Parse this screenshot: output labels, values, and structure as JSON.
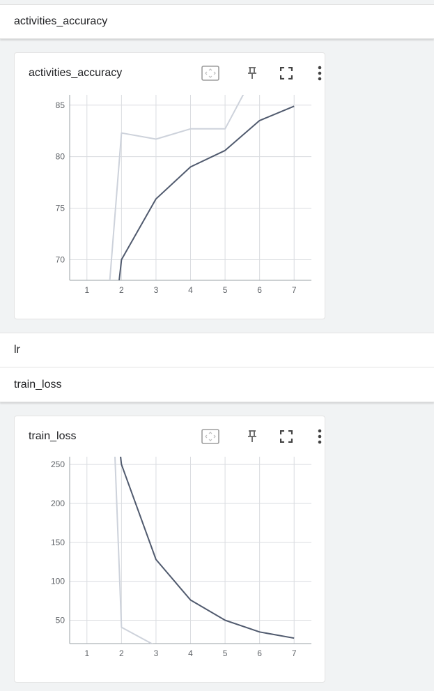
{
  "sections": {
    "activities_header": "activities_accuracy",
    "lr_header": "lr",
    "train_loss_header": "train_loss"
  },
  "cards": [
    {
      "title": "activities_accuracy",
      "tools": [
        "fit-domain-icon",
        "pin-icon",
        "fullscreen-icon",
        "more-vert-icon"
      ]
    },
    {
      "title": "train_loss",
      "tools": [
        "fit-domain-icon",
        "pin-icon",
        "fullscreen-icon",
        "more-vert-icon"
      ]
    }
  ],
  "colors": {
    "main_series": "#505a6e",
    "faded_series": "#cdd2db",
    "grid": "#dadce0",
    "axis": "#9aa0a6"
  },
  "chart_data": [
    {
      "type": "line",
      "title": "activities_accuracy",
      "x_ticks": [
        1,
        2,
        3,
        4,
        5,
        6,
        7
      ],
      "y_ticks": [
        70,
        75,
        80,
        85
      ],
      "xlim": [
        0.5,
        7.5
      ],
      "ylim": [
        68,
        86
      ],
      "series": [
        {
          "role": "raw",
          "x": [
            1,
            2,
            3,
            4,
            5,
            6
          ],
          "y": [
            40,
            82.3,
            81.7,
            82.7,
            82.7,
            89.0
          ]
        },
        {
          "role": "smoothed",
          "x": [
            1,
            2,
            3,
            4,
            5,
            6,
            7
          ],
          "y": [
            40,
            70.0,
            75.9,
            79.0,
            80.6,
            83.5,
            84.9
          ]
        }
      ]
    },
    {
      "type": "line",
      "title": "train_loss",
      "x_ticks": [
        1,
        2,
        3,
        4,
        5,
        6,
        7
      ],
      "y_ticks": [
        50,
        100,
        150,
        200,
        250
      ],
      "xlim": [
        0.5,
        7.5
      ],
      "ylim": [
        20,
        260
      ],
      "series": [
        {
          "role": "raw",
          "x": [
            1,
            2,
            3
          ],
          "y": [
            1200,
            41,
            17
          ]
        },
        {
          "role": "smoothed",
          "x": [
            1,
            2,
            3,
            4,
            5,
            6,
            7
          ],
          "y": [
            600,
            250,
            128,
            76,
            50,
            35,
            27
          ]
        }
      ]
    }
  ]
}
